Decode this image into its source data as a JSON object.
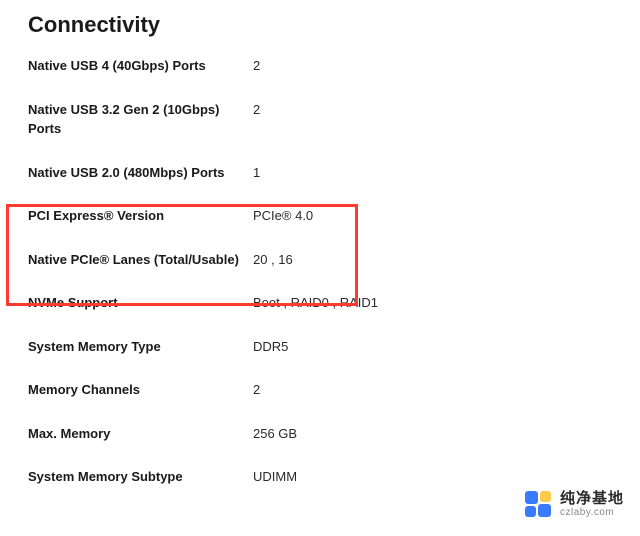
{
  "section_title": "Connectivity",
  "specs": [
    {
      "label": "Native USB 4 (40Gbps) Ports",
      "value": "2"
    },
    {
      "label": "Native USB 3.2 Gen 2 (10Gbps) Ports",
      "value": "2"
    },
    {
      "label": "Native USB 2.0 (480Mbps) Ports",
      "value": "1"
    },
    {
      "label": "PCI Express® Version",
      "value": "PCIe® 4.0"
    },
    {
      "label": "Native PCIe® Lanes (Total/Usable)",
      "value": "20 , 16"
    },
    {
      "label": "NVMe Support",
      "value": "Boot , RAID0 , RAID1"
    },
    {
      "label": "System Memory Type",
      "value": "DDR5"
    },
    {
      "label": "Memory Channels",
      "value": "2"
    },
    {
      "label": "Max. Memory",
      "value": "256 GB"
    },
    {
      "label": "System Memory Subtype",
      "value": "UDIMM"
    }
  ],
  "highlighted_indices": [
    3,
    4
  ],
  "watermark": {
    "main": "纯净基地",
    "sub": "czlaby.com"
  }
}
